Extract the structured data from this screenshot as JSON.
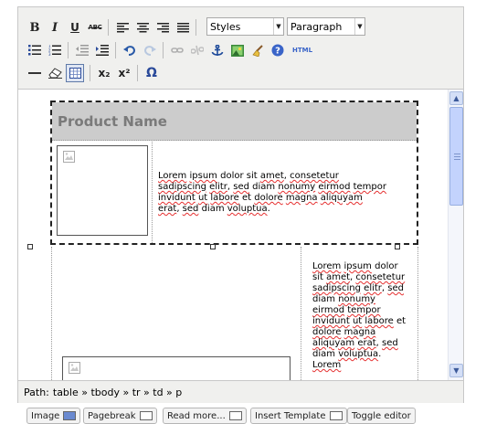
{
  "toolbar": {
    "row1": {
      "bold_label": "B",
      "italic_label": "I",
      "underline_label": "U",
      "strike_label": "ABC",
      "styles_select": {
        "value": "Styles"
      },
      "format_select": {
        "value": "Paragraph"
      }
    },
    "row2": {
      "html_label": "HTML"
    },
    "row3": {
      "subscript_label": "x₂",
      "superscript_label": "x²",
      "omega_label": "Ω"
    }
  },
  "content": {
    "product_name": "Product Name",
    "first_paragraph": [
      {
        "t": "Lorem",
        "s": true
      },
      {
        "t": " "
      },
      {
        "t": "ipsum",
        "s": true
      },
      {
        "t": " dolor sit "
      },
      {
        "t": "amet",
        "s": true
      },
      {
        "t": ", "
      },
      {
        "t": "consetetur",
        "s": true
      },
      {
        "t": " "
      },
      {
        "t": "sadipscing",
        "s": true
      },
      {
        "t": " "
      },
      {
        "t": "elitr",
        "s": true
      },
      {
        "t": ", "
      },
      {
        "t": "sed",
        "s": true
      },
      {
        "t": " diam "
      },
      {
        "t": "nonumy",
        "s": true
      },
      {
        "t": " "
      },
      {
        "t": "eirmod",
        "s": true
      },
      {
        "t": " "
      },
      {
        "t": "tempor",
        "s": true
      },
      {
        "t": " "
      },
      {
        "t": "invidunt",
        "s": true
      },
      {
        "t": " "
      },
      {
        "t": "ut",
        "s": true
      },
      {
        "t": " "
      },
      {
        "t": "labore",
        "s": true
      },
      {
        "t": " et "
      },
      {
        "t": "dolore",
        "s": true
      },
      {
        "t": " "
      },
      {
        "t": "magna",
        "s": true
      },
      {
        "t": " "
      },
      {
        "t": "aliquyam",
        "s": true
      },
      {
        "t": " "
      },
      {
        "t": "erat",
        "s": true
      },
      {
        "t": ", "
      },
      {
        "t": "sed",
        "s": true
      },
      {
        "t": " diam "
      },
      {
        "t": "voluptua",
        "s": true
      },
      {
        "t": "."
      }
    ],
    "second_paragraph": [
      {
        "t": "Lorem",
        "s": true
      },
      {
        "t": " "
      },
      {
        "t": "ipsum",
        "s": true
      },
      {
        "t": " dolor sit "
      },
      {
        "t": "amet",
        "s": true
      },
      {
        "t": ", "
      },
      {
        "t": "consetetur",
        "s": true
      },
      {
        "t": " "
      },
      {
        "t": "sadipscing",
        "s": true
      },
      {
        "t": " "
      },
      {
        "t": "elitr",
        "s": true
      },
      {
        "t": ", "
      },
      {
        "t": "sed",
        "s": true
      },
      {
        "t": " diam "
      },
      {
        "t": "nonumy",
        "s": true
      },
      {
        "t": " "
      },
      {
        "t": "eirmod",
        "s": true
      },
      {
        "t": " "
      },
      {
        "t": "tempor",
        "s": true
      },
      {
        "t": " "
      },
      {
        "t": "invidunt",
        "s": true
      },
      {
        "t": " "
      },
      {
        "t": "ut",
        "s": true
      },
      {
        "t": " "
      },
      {
        "t": "labore",
        "s": true
      },
      {
        "t": " et "
      },
      {
        "t": "dolore",
        "s": true
      },
      {
        "t": " "
      },
      {
        "t": "magna",
        "s": true
      },
      {
        "t": " "
      },
      {
        "t": "aliquyam",
        "s": true
      },
      {
        "t": " "
      },
      {
        "t": "erat",
        "s": true
      },
      {
        "t": ", "
      },
      {
        "t": "sed",
        "s": true
      },
      {
        "t": " diam "
      },
      {
        "t": "voluptua",
        "s": true
      },
      {
        "t": ". "
      },
      {
        "t": "Lorem",
        "s": true
      }
    ]
  },
  "path_bar": {
    "label": "Path:",
    "value": "table » tbody » tr » td » p"
  },
  "bottom_buttons": [
    {
      "label": "Image"
    },
    {
      "label": "Pagebreak"
    },
    {
      "label": "Read more..."
    },
    {
      "label": "Insert Template"
    },
    {
      "label": "Toggle editor"
    }
  ],
  "colors": {
    "toolbar_bg": "#f0f0ee",
    "header_cell_bg": "#cccccc",
    "header_text": "#7a7a7a",
    "link_blue": "#2255aa",
    "spellcheck_red": "#e53030"
  }
}
